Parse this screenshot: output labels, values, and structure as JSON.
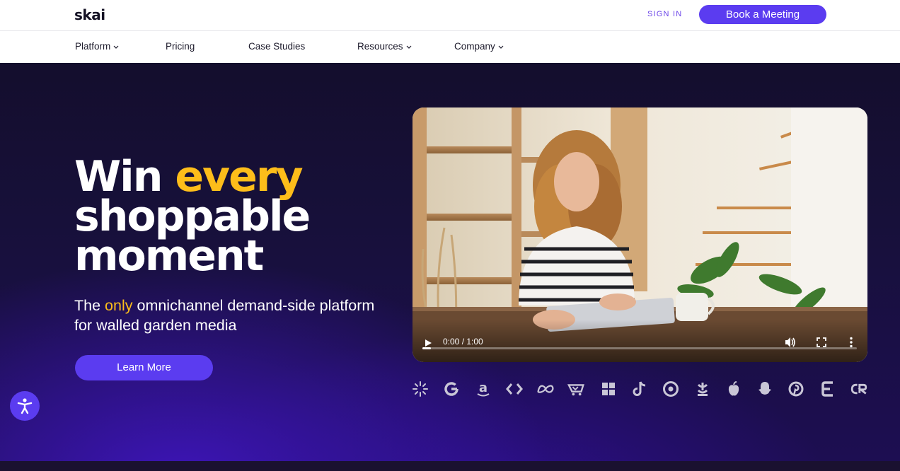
{
  "brand": {
    "logo_text": "skai"
  },
  "header": {
    "sign_in": "SIGN IN",
    "book_meeting": "Book a Meeting"
  },
  "nav": {
    "items": [
      {
        "label": "Platform",
        "has_dropdown": true
      },
      {
        "label": "Pricing",
        "has_dropdown": false
      },
      {
        "label": "Case Studies",
        "has_dropdown": false
      },
      {
        "label": "Resources",
        "has_dropdown": true
      },
      {
        "label": "Company",
        "has_dropdown": true
      }
    ]
  },
  "hero": {
    "headline_word_1": "Win",
    "headline_accent": "every",
    "headline_line_2": "shoppable",
    "headline_line_3": "moment",
    "subtitle_prefix": "The",
    "subtitle_accent": "only",
    "subtitle_rest": "omnichannel demand-side platform for walled garden media",
    "cta": "Learn More"
  },
  "video": {
    "time": "0:00 / 1:00",
    "progress": 0.02
  },
  "partner_logos": [
    "walmart-icon",
    "google-icon",
    "amazon-icon",
    "code-brackets-icon",
    "meta-icon",
    "instacart-icon",
    "microsoft-icon",
    "tiktok-icon",
    "target-icon",
    "kroger-icon",
    "apple-icon",
    "snapchat-icon",
    "pinterest-icon",
    "e-logo-icon",
    "criteo-icon"
  ],
  "colors": {
    "accent_yellow": "#fdbd1a",
    "brand_purple": "#5b3cf0",
    "hero_bg": "#17103a"
  }
}
